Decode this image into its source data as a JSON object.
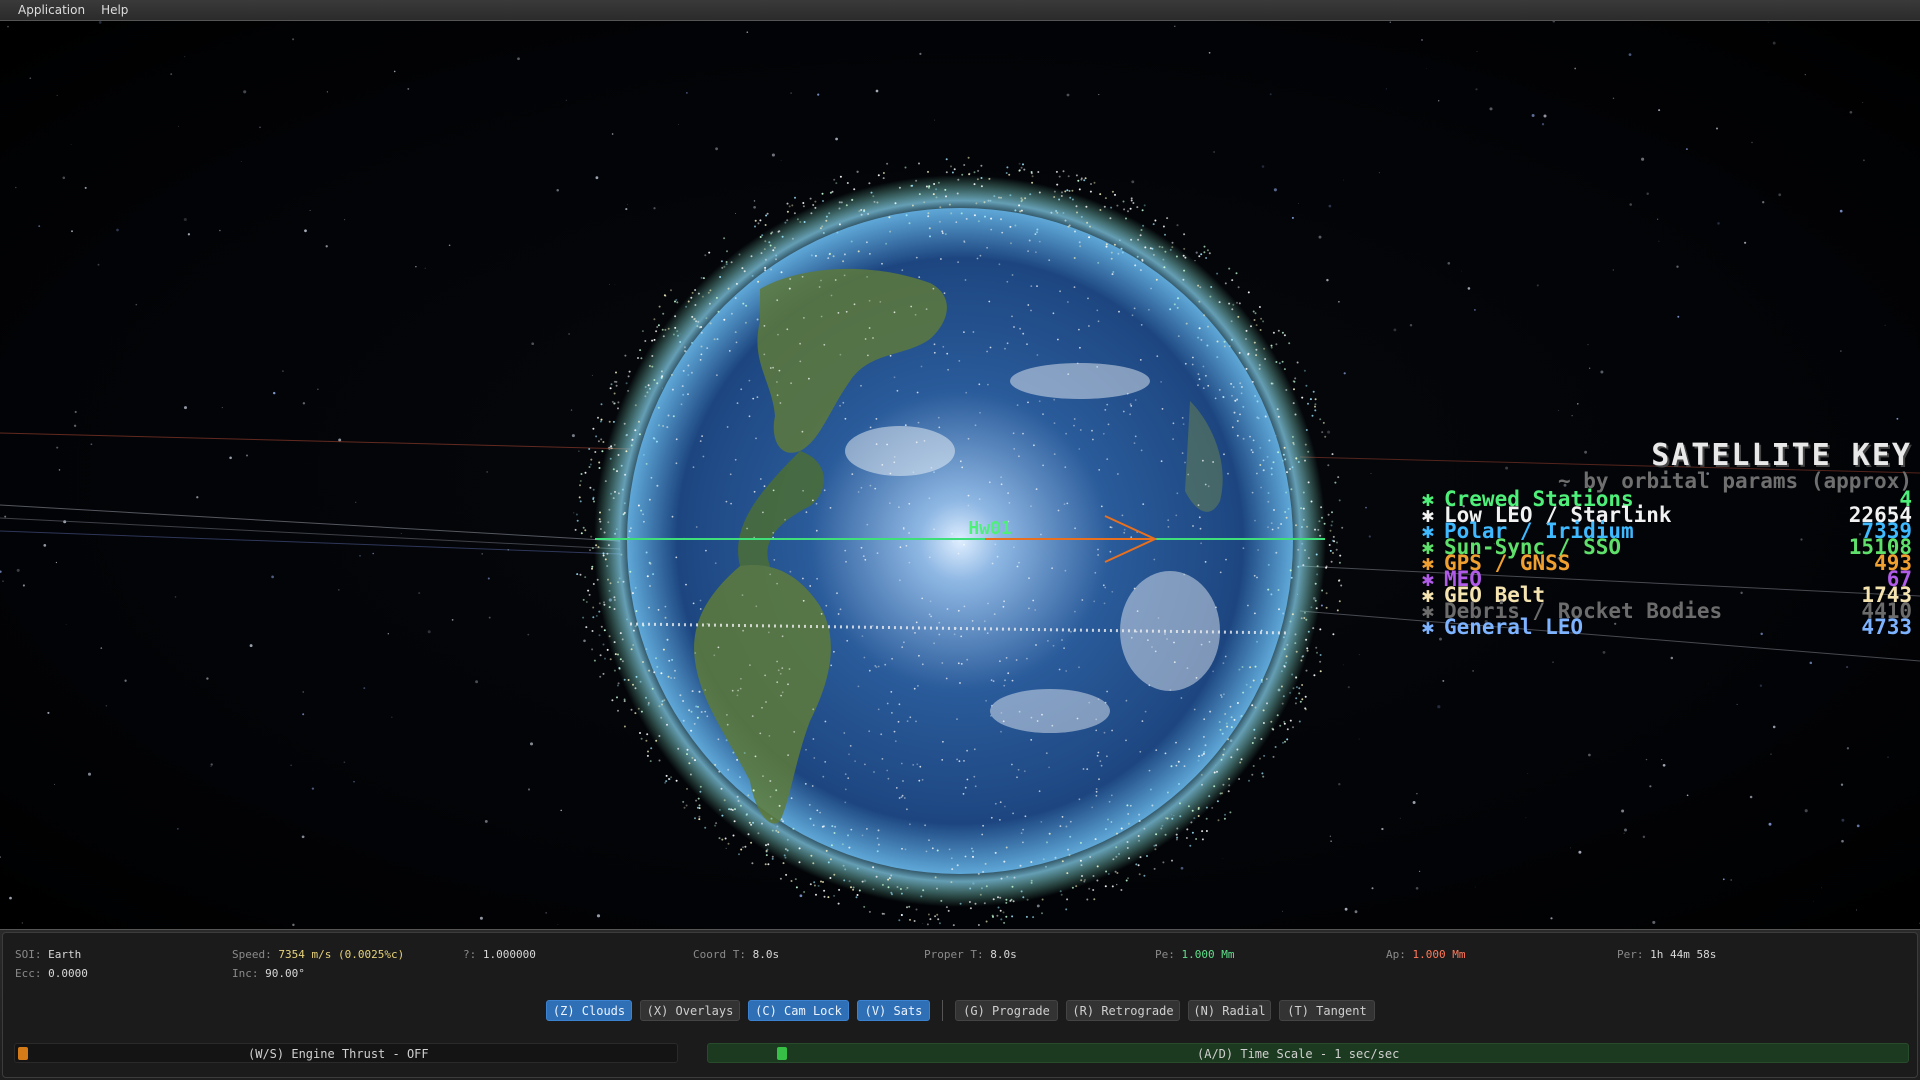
{
  "menu": {
    "items": [
      "Application",
      "Help"
    ]
  },
  "scene": {
    "vessel_label": "Hw01"
  },
  "satellite_key": {
    "title": "SATELLITE KEY",
    "subtitle": "~ by orbital params (approx)",
    "rows": [
      {
        "name": "Crewed Stations",
        "count": "4",
        "color": "#4ff07a"
      },
      {
        "name": "Low LEO / Starlink",
        "count": "22654",
        "color": "#f2f2f2"
      },
      {
        "name": "Polar / Iridium",
        "count": "7339",
        "color": "#3fb9ff"
      },
      {
        "name": "Sun-Sync / SSO",
        "count": "15108",
        "color": "#5ee06a"
      },
      {
        "name": "GPS / GNSS",
        "count": "493",
        "color": "#f0a030"
      },
      {
        "name": "MEO",
        "count": "67",
        "color": "#b05ce8"
      },
      {
        "name": "GEO Belt",
        "count": "1743",
        "color": "#f5e4b0"
      },
      {
        "name": "Debris / Rocket Bodies",
        "count": "4410",
        "color": "#6c6c6c"
      },
      {
        "name": "General LEO",
        "count": "4733",
        "color": "#7db3ff"
      }
    ]
  },
  "stats": {
    "soi_label": "SOI:",
    "soi_value": "Earth",
    "ecc_label": "Ecc:",
    "ecc_value": "0.0000",
    "speed_label": "Speed:",
    "speed_value": "7354 m/s (0.0025%c)",
    "inc_label": "Inc:",
    "inc_value": "90.00°",
    "gamma_label": "?:",
    "gamma_value": "1.000000",
    "coord_label": "Coord T:",
    "coord_value": "8.0s",
    "proper_label": "Proper T:",
    "proper_value": "8.0s",
    "pe_label": "Pe:",
    "pe_value": "1.000 Mm",
    "ap_label": "Ap:",
    "ap_value": "1.000 Mm",
    "per_label": "Per:",
    "per_value": "1h 44m 58s",
    "colors": {
      "speed": "#e6d27a",
      "pe": "#5fe08a",
      "ap": "#ff7a5a"
    }
  },
  "toggles": {
    "clouds": "(Z) Clouds",
    "overlays": "(X) Overlays",
    "camlock": "(C) Cam Lock",
    "sats": "(V) Sats",
    "prograde": "(G) Prograde",
    "retrograde": "(R) Retrograde",
    "radial": "(N) Radial",
    "tangent": "(T) Tangent"
  },
  "thrust": {
    "label": "(W/S)  Engine Thrust  -  OFF",
    "level": 0.0
  },
  "timescale": {
    "label": "(A/D)  Time Scale  -  1 sec/sec",
    "position": 0.05
  }
}
